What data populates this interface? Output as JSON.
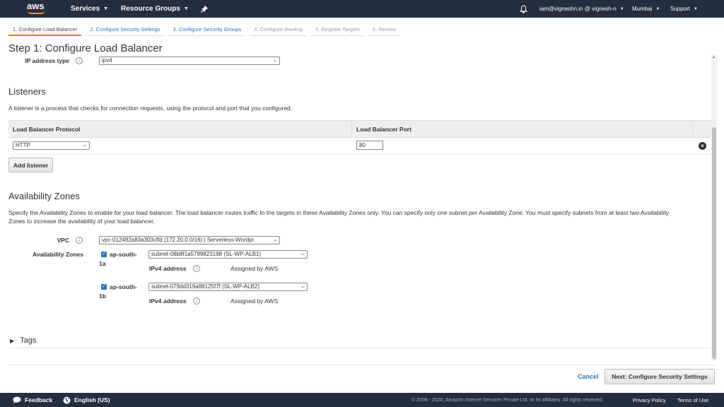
{
  "nav": {
    "logo_text": "aws",
    "services": "Services",
    "resource_groups": "Resource Groups",
    "user": "iam@vigneshn.in @ vignesh-n",
    "region": "Mumbai",
    "support": "Support"
  },
  "steps": [
    {
      "label": "1. Configure Load Balancer",
      "state": "active"
    },
    {
      "label": "2. Configure Security Settings",
      "state": "link"
    },
    {
      "label": "3. Configure Security Groups",
      "state": "link"
    },
    {
      "label": "4. Configure Routing",
      "state": "disabled"
    },
    {
      "label": "5. Register Targets",
      "state": "disabled"
    },
    {
      "label": "6. Review",
      "state": "disabled"
    }
  ],
  "page_title": "Step 1: Configure Load Balancer",
  "ip_address_type": {
    "label": "IP address type",
    "value": "ipv4"
  },
  "listeners": {
    "heading": "Listeners",
    "description": "A listener is a process that checks for connection requests, using the protocol and port that you configured.",
    "col_protocol": "Load Balancer Protocol",
    "col_port": "Load Balancer Port",
    "rows": [
      {
        "protocol": "HTTP",
        "port": "80"
      }
    ],
    "add_button": "Add listener"
  },
  "availability_zones": {
    "heading": "Availability Zones",
    "description_line1": "Specify the Availability Zones to enable for your load balancer. The load balancer routes traffic to the targets in these Availability Zones only. You can specify only one subnet per Availability Zone. You must specify subnets from at least two Availability",
    "description_line2": "Zones to increase the availability of your load balancer.",
    "vpc_label": "VPC",
    "vpc_value": "vpc-012492a83a303cffd (172.20.0.0/16) | Serverless-Wordpr",
    "zones_label": "Availability Zones",
    "zones": [
      {
        "name_line1": "ap-south-",
        "name_line2": "1a",
        "subnet": "subnet-08b8f1a5799823198 (SL-WP-ALB1)",
        "ipv4_label": "IPv4 address",
        "ipv4_value": "Assigned by AWS"
      },
      {
        "name_line1": "ap-south-",
        "name_line2": "1b",
        "subnet": "subnet-079dd319a88125f7f (SL-WP-ALB2)",
        "ipv4_label": "IPv4 address",
        "ipv4_value": "Assigned by AWS"
      }
    ]
  },
  "tags": {
    "label": "Tags"
  },
  "actions": {
    "cancel": "Cancel",
    "next": "Next: Configure Security Settings"
  },
  "footer": {
    "feedback": "Feedback",
    "language": "English (US)",
    "copyright": "© 2008 - 2020, Amazon Internet Services Private Ltd. or its affiliates. All rights reserved.",
    "privacy": "Privacy Policy",
    "terms": "Terms of Use"
  },
  "colors": {
    "nav_bg": "#232f3e",
    "accent_orange": "#e47911",
    "link_blue": "#2a73b8"
  }
}
